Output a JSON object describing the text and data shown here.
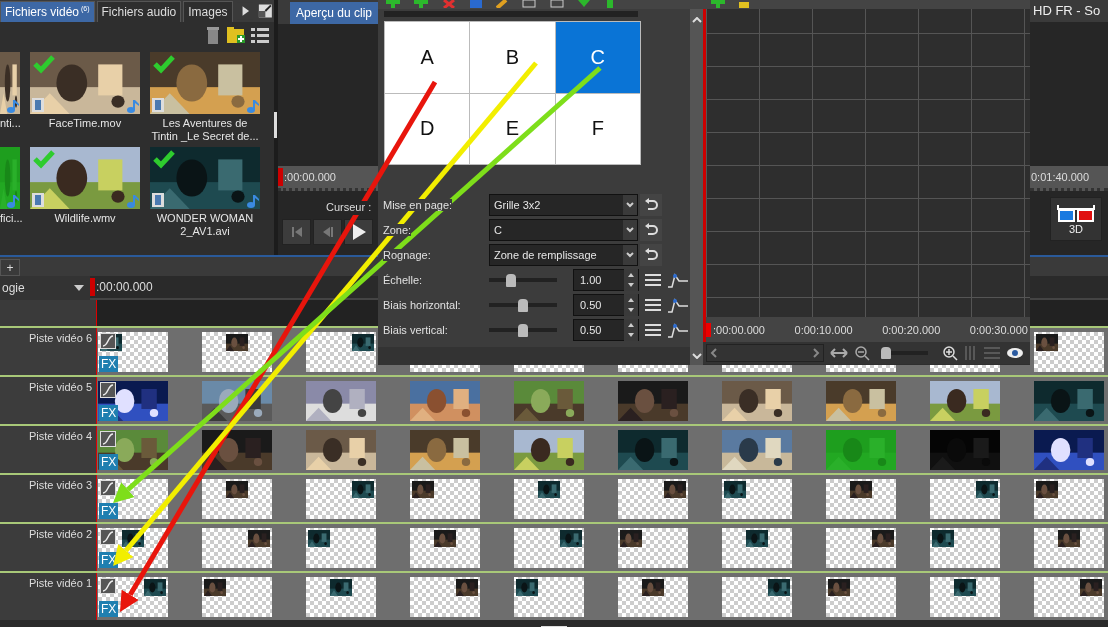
{
  "media_panel": {
    "tabs": [
      {
        "label": "Fichiers vidéo",
        "count": "(6)",
        "selected": true
      },
      {
        "label": "Fichiers audio",
        "selected": false
      },
      {
        "label": "Images",
        "selected": false
      }
    ],
    "items": [
      {
        "kind": "partial",
        "name": "nti...",
        "checked": false
      },
      {
        "kind": "full",
        "name": "FaceTime.mov",
        "checked": true
      },
      {
        "kind": "full",
        "name": "Les Aventures de Tintin _Le Secret de...",
        "checked": true
      },
      {
        "kind": "partial",
        "name": "fici...",
        "checked": false
      },
      {
        "kind": "full",
        "name": "Wildlife.wmv",
        "checked": true
      },
      {
        "kind": "full",
        "name": "WONDER WOMAN 2_AV1.avi",
        "checked": true
      }
    ]
  },
  "clip_preview": {
    "tab": "Aperçu du clip",
    "time": ":00:00.000",
    "cursor_label": "Curseur :"
  },
  "main_preview": {
    "title": "HD FR - So",
    "time": "0:01:40.000",
    "button": "3D"
  },
  "effect_dialog": {
    "cells": [
      {
        "label": "A",
        "selected": false
      },
      {
        "label": "B",
        "selected": false
      },
      {
        "label": "C",
        "selected": true
      },
      {
        "label": "D",
        "selected": false
      },
      {
        "label": "E",
        "selected": false
      },
      {
        "label": "F",
        "selected": false
      }
    ],
    "fields": [
      {
        "kind": "select",
        "label": "Mise en page:",
        "value": "Grille 3x2"
      },
      {
        "kind": "select",
        "label": "Zone:",
        "value": "C"
      },
      {
        "kind": "select",
        "label": "Rognage:",
        "value": "Zone de remplissage"
      },
      {
        "kind": "slider",
        "label": "Échelle:",
        "level": 0.33,
        "value": "1.00"
      },
      {
        "kind": "slider",
        "label": "Biais horizontal:",
        "level": 0.5,
        "value": "0.50"
      },
      {
        "kind": "slider",
        "label": "Biais vertical:",
        "level": 0.5,
        "value": "0.50"
      }
    ]
  },
  "keyframe_window": {
    "ruler": [
      ":00:00.000",
      "0:00:10.000",
      "0:00:20.000",
      "0:00:30.000"
    ],
    "zoom_slider": {
      "level": 0.05
    }
  },
  "timeline": {
    "tab": "+",
    "dropdown": "ogie",
    "ruler_start": ":00:00.000",
    "tracks": [
      {
        "name": "Piste vidéo 6",
        "fx": "FX",
        "clips": [
          {
            "kind": "inset"
          },
          {
            "kind": "inset"
          },
          {
            "kind": "inset"
          },
          {
            "kind": "blank"
          },
          {
            "kind": "blank"
          },
          {
            "kind": "blank"
          },
          {
            "kind": "blank"
          },
          {
            "kind": "blank"
          },
          {
            "kind": "blank"
          },
          {
            "kind": "inset"
          }
        ]
      },
      {
        "name": "Piste vidéo 5",
        "fx": "FX"
      },
      {
        "name": "Piste vidéo 4",
        "fx": "FX"
      },
      {
        "name": "Piste vidéo 3",
        "fx": "FX",
        "clips": [
          {
            "kind": "blank"
          },
          {
            "kind": "inset"
          },
          {
            "kind": "inset"
          },
          {
            "kind": "inset"
          },
          {
            "kind": "inset"
          },
          {
            "kind": "inset"
          },
          {
            "kind": "inset"
          },
          {
            "kind": "inset"
          },
          {
            "kind": "inset"
          },
          {
            "kind": "inset"
          }
        ]
      },
      {
        "name": "Piste vidéo 2",
        "fx": "FX",
        "clips": [
          {
            "kind": "inset"
          },
          {
            "kind": "inset"
          },
          {
            "kind": "inset"
          },
          {
            "kind": "inset"
          },
          {
            "kind": "inset"
          },
          {
            "kind": "inset"
          },
          {
            "kind": "inset"
          },
          {
            "kind": "inset"
          },
          {
            "kind": "inset"
          },
          {
            "kind": "inset"
          }
        ]
      },
      {
        "name": "Piste vidéo 1",
        "fx": "FX",
        "clips": [
          {
            "kind": "inset"
          },
          {
            "kind": "inset"
          },
          {
            "kind": "inset"
          },
          {
            "kind": "inset"
          },
          {
            "kind": "inset"
          },
          {
            "kind": "inset"
          },
          {
            "kind": "inset"
          },
          {
            "kind": "inset"
          },
          {
            "kind": "inset"
          },
          {
            "kind": "inset"
          }
        ]
      }
    ]
  },
  "arrows": [
    {
      "color": "#e8150c"
    },
    {
      "color": "#f2ee00"
    },
    {
      "color": "#7ede1a"
    }
  ]
}
